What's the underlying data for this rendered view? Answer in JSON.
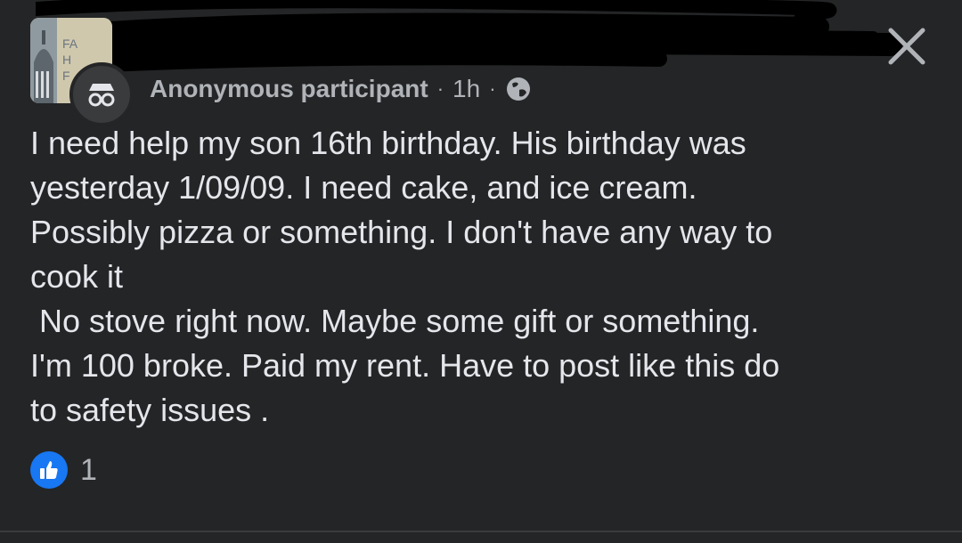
{
  "post": {
    "author": "Anonymous participant",
    "time": "1h",
    "separator": "·",
    "body": "I need help my son 16th birthday. His birthday was\nyesterday 1/09/09. I need cake, and ice cream.\nPossibly pizza or something. I don't have any way to\ncook it\n No stove right now. Maybe some gift or something.\nI'm 100 broke. Paid my rent. Have to post like this do\nto safety issues .",
    "privacy_icon": "globe-icon"
  },
  "reactions": {
    "icon": "thumbs-up-icon",
    "count": "1"
  },
  "colors": {
    "background": "#242526",
    "text": "#e4e6eb",
    "secondary_text": "#b0b3b8",
    "like_blue": "#1877f2"
  }
}
